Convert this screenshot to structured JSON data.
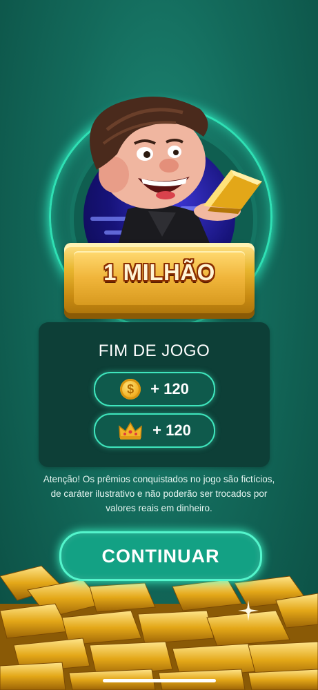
{
  "banner": {
    "prize_label": "1 MILHÃO"
  },
  "panel": {
    "title": "FIM DE JOGO",
    "rewards": [
      {
        "icon": "coin-icon",
        "value": "+ 120"
      },
      {
        "icon": "crown-icon",
        "value": "+ 120"
      }
    ]
  },
  "notice": "Atenção! Os prêmios conquistados no jogo são fictícios, de caráter ilustrativo e não poderão ser trocados por valores reais em dinheiro.",
  "continue_button": {
    "label": "CONTINUAR"
  },
  "colors": {
    "background": "#136a5b",
    "accent": "#3fe6bd",
    "button": "#13a184",
    "gold": "#e8b62f"
  }
}
